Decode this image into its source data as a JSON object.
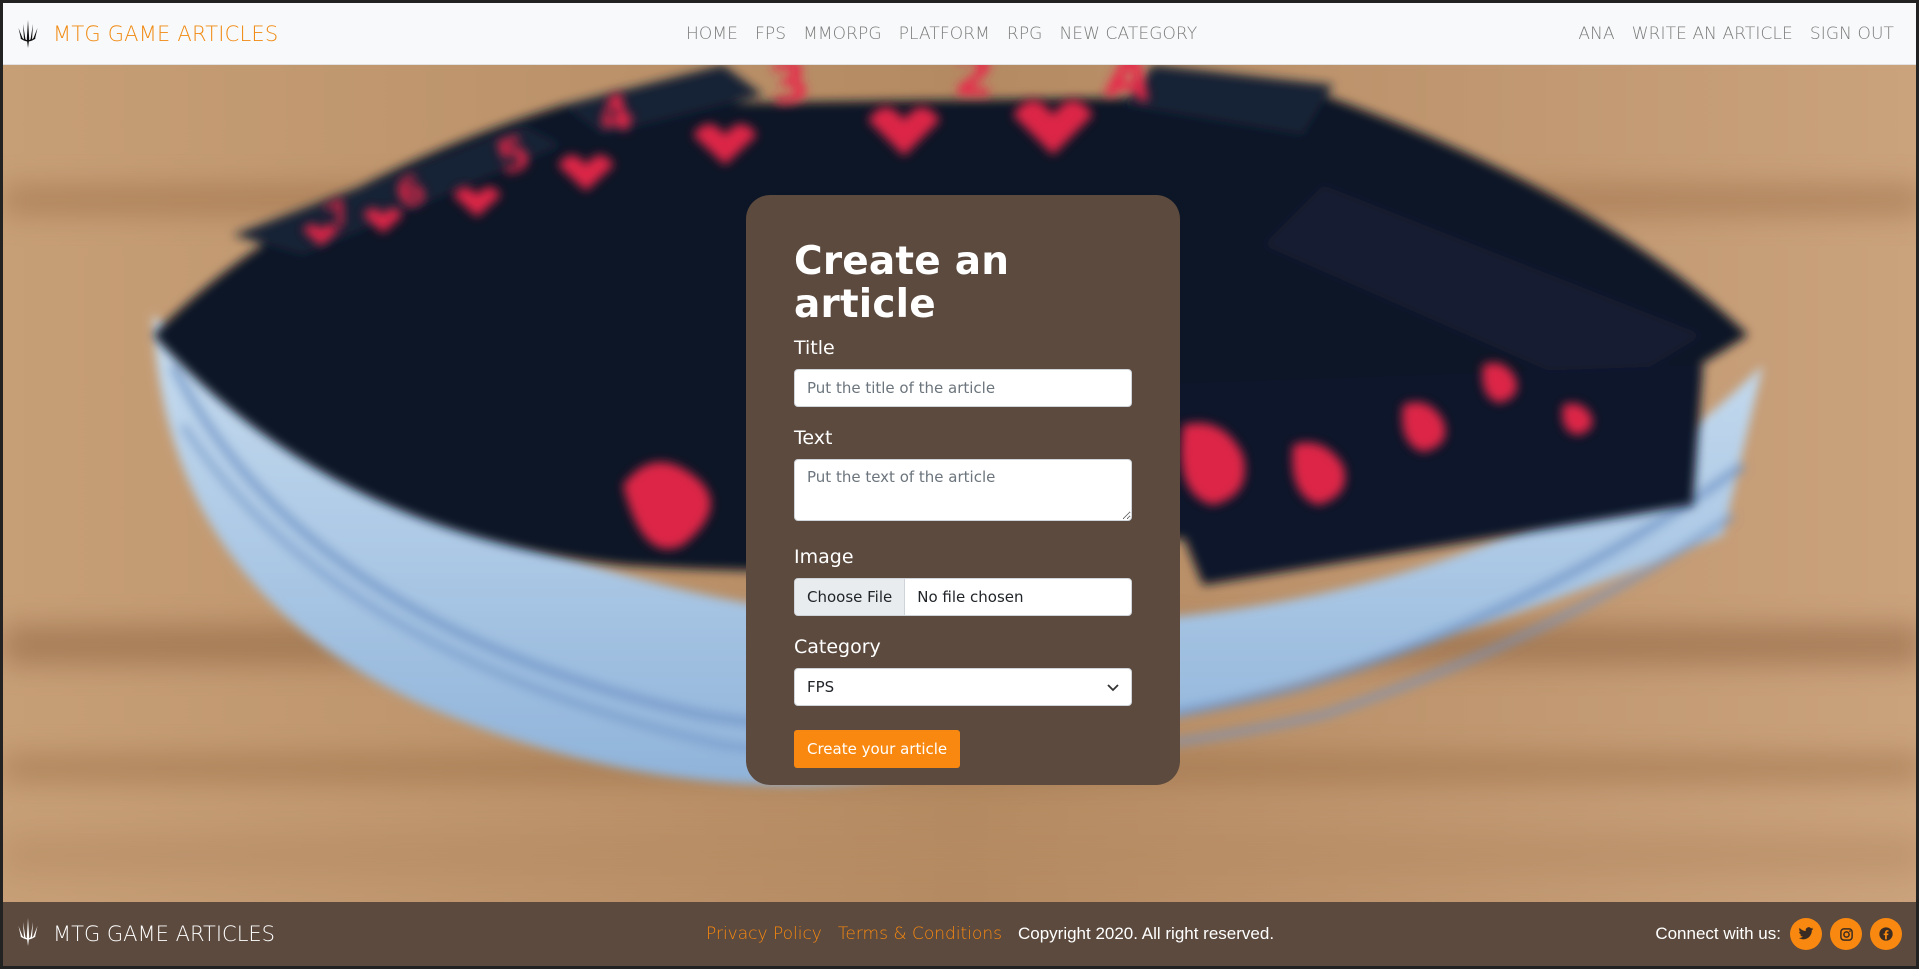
{
  "navbar": {
    "brand": "MTG GAME ARTICLES",
    "brand_color": "#f08a12",
    "center_links": [
      "HOME",
      "FPS",
      "MMORPG",
      "PLATFORM",
      "RPG",
      "NEW CATEGORY"
    ],
    "right_links": [
      "ANA",
      "WRITE AN ARTICLE",
      "SIGN OUT"
    ]
  },
  "form": {
    "heading": "Create an article",
    "title_label": "Title",
    "title_placeholder": "Put the title of the article",
    "text_label": "Text",
    "text_placeholder": "Put the text of the article",
    "image_label": "Image",
    "file_button": "Choose File",
    "file_status": "No file chosen",
    "category_label": "Category",
    "category_selected": "FPS",
    "submit_label": "Create your article"
  },
  "footer": {
    "brand": "MTG GAME ARTICLES",
    "privacy": "Privacy Policy",
    "terms": "Terms & Conditions",
    "copyright": "Copyright 2020. All right reserved.",
    "connect": "Connect with us:",
    "social_icons": [
      "twitter-icon",
      "instagram-icon",
      "facebook-icon"
    ]
  },
  "colors": {
    "accent": "#f8880f",
    "card_bg": "#5c4a3e",
    "footer_bg": "#5c4a3e",
    "navbar_bg": "#f8f9fa"
  }
}
